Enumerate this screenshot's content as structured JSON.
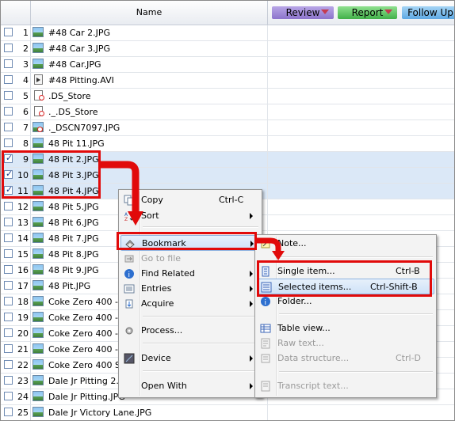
{
  "header": {
    "name_col": "Name",
    "tags": [
      {
        "label": "Review",
        "color": "#9a84d6"
      },
      {
        "label": "Report",
        "color": "#5cc15f"
      },
      {
        "label": "Follow Up",
        "color": "#7ebbec"
      }
    ]
  },
  "rows": [
    {
      "num": "1",
      "name": "#48 Car 2.JPG",
      "icon": "image-file-icon",
      "checked": false
    },
    {
      "num": "2",
      "name": "#48 Car 3.JPG",
      "icon": "image-file-icon",
      "checked": false
    },
    {
      "num": "3",
      "name": "#48 Car.JPG",
      "icon": "image-file-icon",
      "checked": false
    },
    {
      "num": "4",
      "name": "#48 Pitting.AVI",
      "icon": "video-file-icon",
      "checked": false
    },
    {
      "num": "5",
      "name": ".DS_Store",
      "icon": "unknown-file-icon",
      "checked": false
    },
    {
      "num": "6",
      "name": "._.DS_Store",
      "icon": "unknown-file-icon",
      "checked": false
    },
    {
      "num": "7",
      "name": "._DSCN7097.JPG",
      "icon": "broken-image-icon",
      "checked": false
    },
    {
      "num": "8",
      "name": "48 Pit 11.JPG",
      "icon": "image-file-icon",
      "checked": false
    },
    {
      "num": "9",
      "name": "48 Pit 2.JPG",
      "icon": "image-file-icon",
      "checked": true
    },
    {
      "num": "10",
      "name": "48 Pit 3.JPG",
      "icon": "image-file-icon",
      "checked": true
    },
    {
      "num": "11",
      "name": "48 Pit 4.JPG",
      "icon": "image-file-icon",
      "checked": true
    },
    {
      "num": "12",
      "name": "48 Pit 5.JPG",
      "icon": "image-file-icon",
      "checked": false
    },
    {
      "num": "13",
      "name": "48 Pit 6.JPG",
      "icon": "image-file-icon",
      "checked": false
    },
    {
      "num": "14",
      "name": "48 Pit 7.JPG",
      "icon": "image-file-icon",
      "checked": false
    },
    {
      "num": "15",
      "name": "48 Pit 8.JPG",
      "icon": "image-file-icon",
      "checked": false
    },
    {
      "num": "16",
      "name": "48 Pit 9.JPG",
      "icon": "image-file-icon",
      "checked": false
    },
    {
      "num": "17",
      "name": "48 Pit.JPG",
      "icon": "image-file-icon",
      "checked": false
    },
    {
      "num": "18",
      "name": "Coke Zero 400 - 2",
      "icon": "image-file-icon",
      "checked": false
    },
    {
      "num": "19",
      "name": "Coke Zero 400 - 2",
      "icon": "image-file-icon",
      "checked": false
    },
    {
      "num": "20",
      "name": "Coke Zero 400 - 2",
      "icon": "image-file-icon",
      "checked": false
    },
    {
      "num": "21",
      "name": "Coke Zero 400 - 2",
      "icon": "image-file-icon",
      "checked": false
    },
    {
      "num": "22",
      "name": "Coke Zero 400 Sc",
      "icon": "image-file-icon",
      "checked": false
    },
    {
      "num": "23",
      "name": "Dale Jr Pitting 2.J",
      "icon": "image-file-icon",
      "checked": false
    },
    {
      "num": "24",
      "name": "Dale Jr Pitting.JPG",
      "icon": "image-file-icon",
      "checked": false
    },
    {
      "num": "25",
      "name": "Dale Jr Victory Lane.JPG",
      "icon": "image-file-icon",
      "checked": false
    }
  ],
  "context_menu": {
    "items": [
      {
        "label": "Copy",
        "shortcut": "Ctrl-C",
        "submenu": false,
        "disabled": false,
        "icon": "copy-icon"
      },
      {
        "label": "Sort",
        "shortcut": "",
        "submenu": true,
        "disabled": false,
        "icon": "sort-icon"
      },
      {
        "label": "Bookmark",
        "shortcut": "",
        "submenu": true,
        "disabled": false,
        "icon": "bookmark-icon"
      },
      {
        "label": "Go to file",
        "shortcut": "",
        "submenu": false,
        "disabled": true,
        "icon": "go-to-file-icon"
      },
      {
        "label": "Find Related",
        "shortcut": "",
        "submenu": true,
        "disabled": false,
        "icon": "find-related-icon"
      },
      {
        "label": "Entries",
        "shortcut": "",
        "submenu": true,
        "disabled": false,
        "icon": "entries-icon"
      },
      {
        "label": "Acquire",
        "shortcut": "",
        "submenu": true,
        "disabled": false,
        "icon": "acquire-icon"
      },
      {
        "label": "Process...",
        "shortcut": "",
        "submenu": false,
        "disabled": false,
        "icon": "process-icon"
      },
      {
        "label": "Device",
        "shortcut": "",
        "submenu": true,
        "disabled": false,
        "icon": "device-icon"
      },
      {
        "label": "Open With",
        "shortcut": "",
        "submenu": true,
        "disabled": false,
        "icon": "open-with-icon"
      }
    ]
  },
  "bookmark_submenu": {
    "items": [
      {
        "label": "Note...",
        "shortcut": "",
        "disabled": false,
        "icon": "note-icon"
      },
      {
        "label": "Single item...",
        "shortcut": "Ctrl-B",
        "disabled": false,
        "icon": "single-item-icon"
      },
      {
        "label": "Selected items...",
        "shortcut": "Ctrl-Shift-B",
        "disabled": false,
        "icon": "selected-items-icon"
      },
      {
        "label": "Folder...",
        "shortcut": "",
        "disabled": false,
        "icon": "folder-icon"
      },
      {
        "label": "Table view...",
        "shortcut": "",
        "disabled": false,
        "icon": "table-view-icon"
      },
      {
        "label": "Raw text...",
        "shortcut": "",
        "disabled": true,
        "icon": "raw-text-icon"
      },
      {
        "label": "Data structure...",
        "shortcut": "Ctrl-D",
        "disabled": true,
        "icon": "data-structure-icon"
      },
      {
        "label": "Transcript text...",
        "shortcut": "",
        "disabled": true,
        "icon": "transcript-icon"
      }
    ]
  },
  "colors": {
    "highlight_red": "#e10a0a",
    "selected_row": "#dbe8f7"
  }
}
